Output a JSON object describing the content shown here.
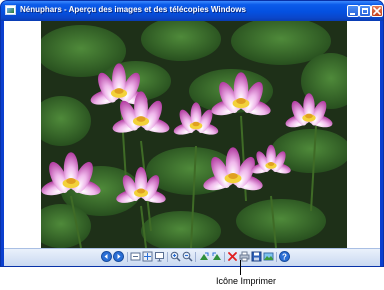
{
  "window": {
    "title": "Nénuphars - Aperçu des images et des télécopies Windows",
    "colors": {
      "titlebar": "#0450e0",
      "frame": "#0a3fcf",
      "close": "#c4401b"
    }
  },
  "titlebar_buttons": [
    {
      "name": "minimize-icon"
    },
    {
      "name": "maximize-icon"
    },
    {
      "name": "close-icon"
    }
  ],
  "image": {
    "subject": "water lilies",
    "colors": {
      "leaves": "#2e5a26",
      "petals": "#e9a6e4",
      "centers": "#f3d23a"
    }
  },
  "toolbar": {
    "buttons": [
      {
        "name": "previous-image-icon"
      },
      {
        "name": "next-image-icon"
      },
      {
        "name": "best-fit-icon"
      },
      {
        "name": "actual-size-icon"
      },
      {
        "name": "slideshow-icon"
      },
      {
        "name": "zoom-in-icon"
      },
      {
        "name": "zoom-out-icon"
      },
      {
        "name": "rotate-clockwise-icon"
      },
      {
        "name": "rotate-counterclockwise-icon"
      },
      {
        "name": "delete-icon"
      },
      {
        "name": "print-icon"
      },
      {
        "name": "save-icon"
      },
      {
        "name": "open-in-editor-icon"
      },
      {
        "name": "help-icon"
      }
    ]
  },
  "callout": {
    "label": "Icône Imprimer"
  }
}
